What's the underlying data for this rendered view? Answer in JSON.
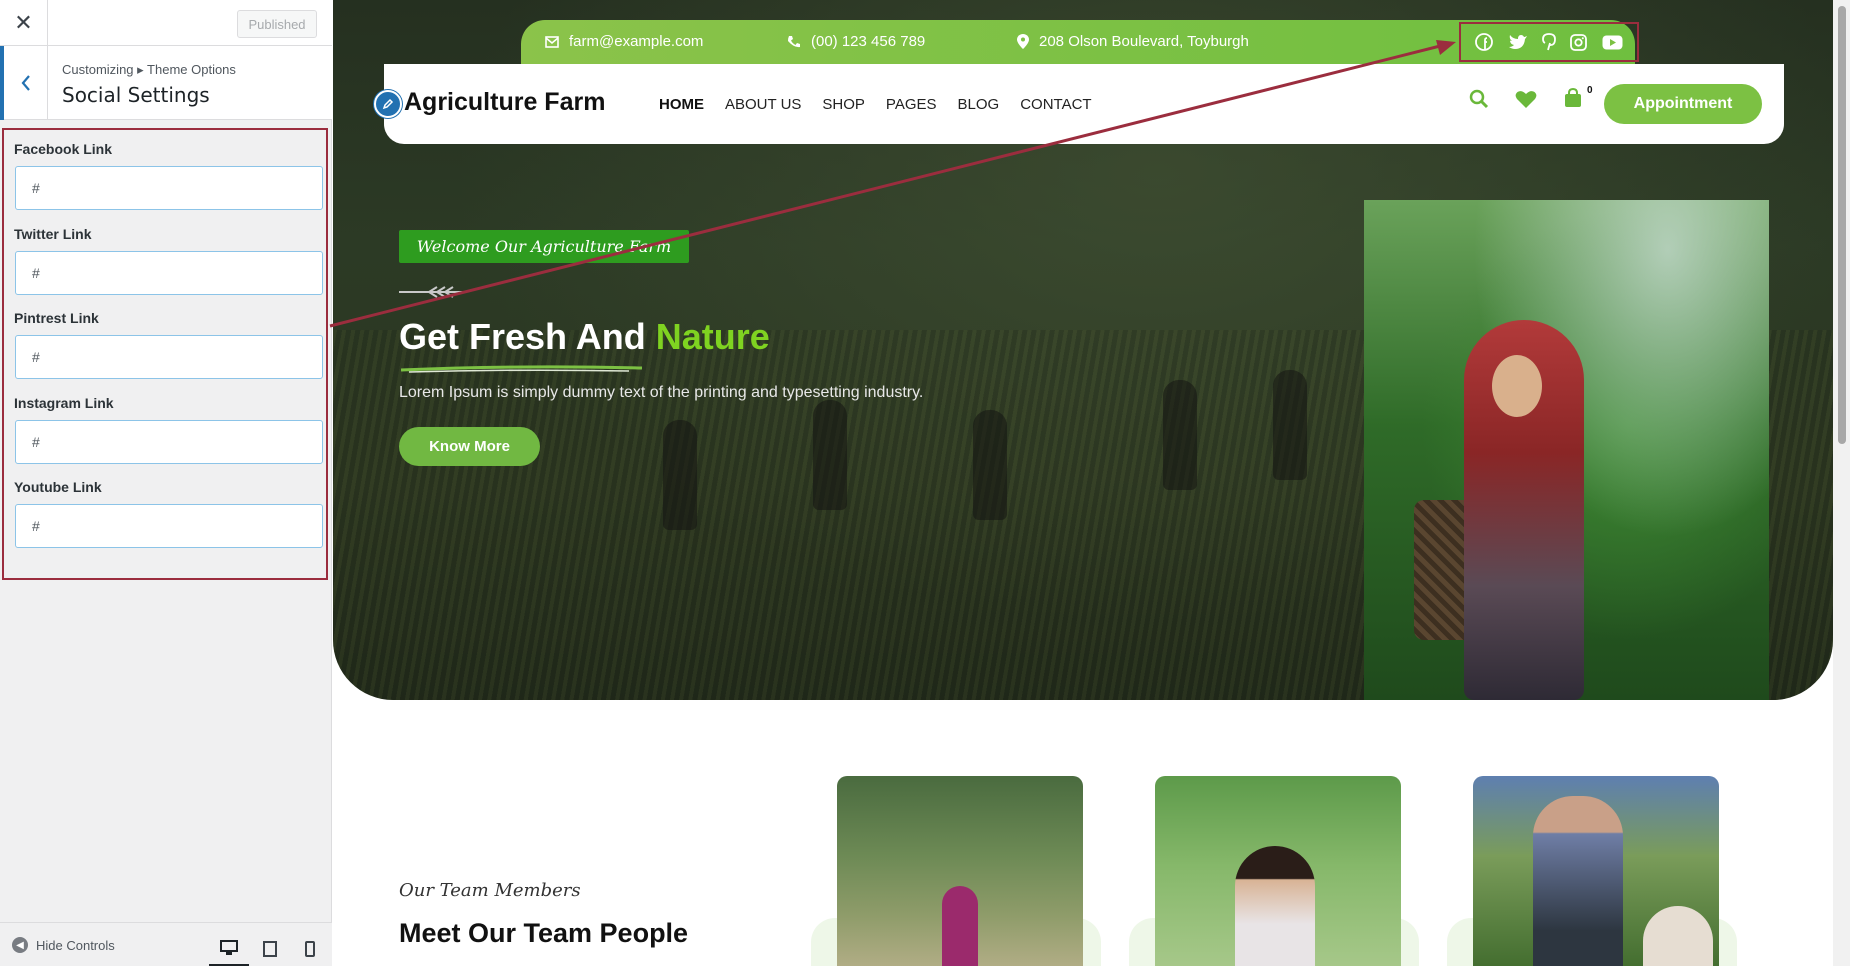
{
  "customizer": {
    "published_label": "Published",
    "breadcrumb": "Customizing ▸ Theme Options",
    "section_title": "Social Settings",
    "fields": [
      {
        "label": "Facebook Link",
        "value": "#"
      },
      {
        "label": "Twitter Link",
        "value": "#"
      },
      {
        "label": "Pintrest Link",
        "value": "#"
      },
      {
        "label": "Instagram Link",
        "value": "#"
      },
      {
        "label": "Youtube Link",
        "value": "#"
      }
    ],
    "hide_controls": "Hide Controls"
  },
  "site": {
    "topbar": {
      "email": "farm@example.com",
      "phone": "(00) 123 456 789",
      "address": "208 Olson Boulevard, Toyburgh"
    },
    "logo": "Agriculture Farm",
    "nav": [
      "HOME",
      "ABOUT US",
      "SHOP",
      "PAGES",
      "BLOG",
      "CONTACT"
    ],
    "cart_count": "0",
    "appointment": "Appointment",
    "hero": {
      "tagline": "Welcome Our Agriculture Farm",
      "title_white": "Get Fresh And",
      "title_green": "Nature",
      "text": "Lorem Ipsum is simply dummy text of the printing and typesetting industry.",
      "cta": "Know More"
    },
    "team": {
      "subtitle": "Our Team Members",
      "title": "Meet Our Team People"
    }
  },
  "colors": {
    "accent_green": "#7cc143",
    "highlight_green": "#7fd321",
    "annotation_red": "#9b2d3e",
    "wp_blue": "#2271b1"
  }
}
